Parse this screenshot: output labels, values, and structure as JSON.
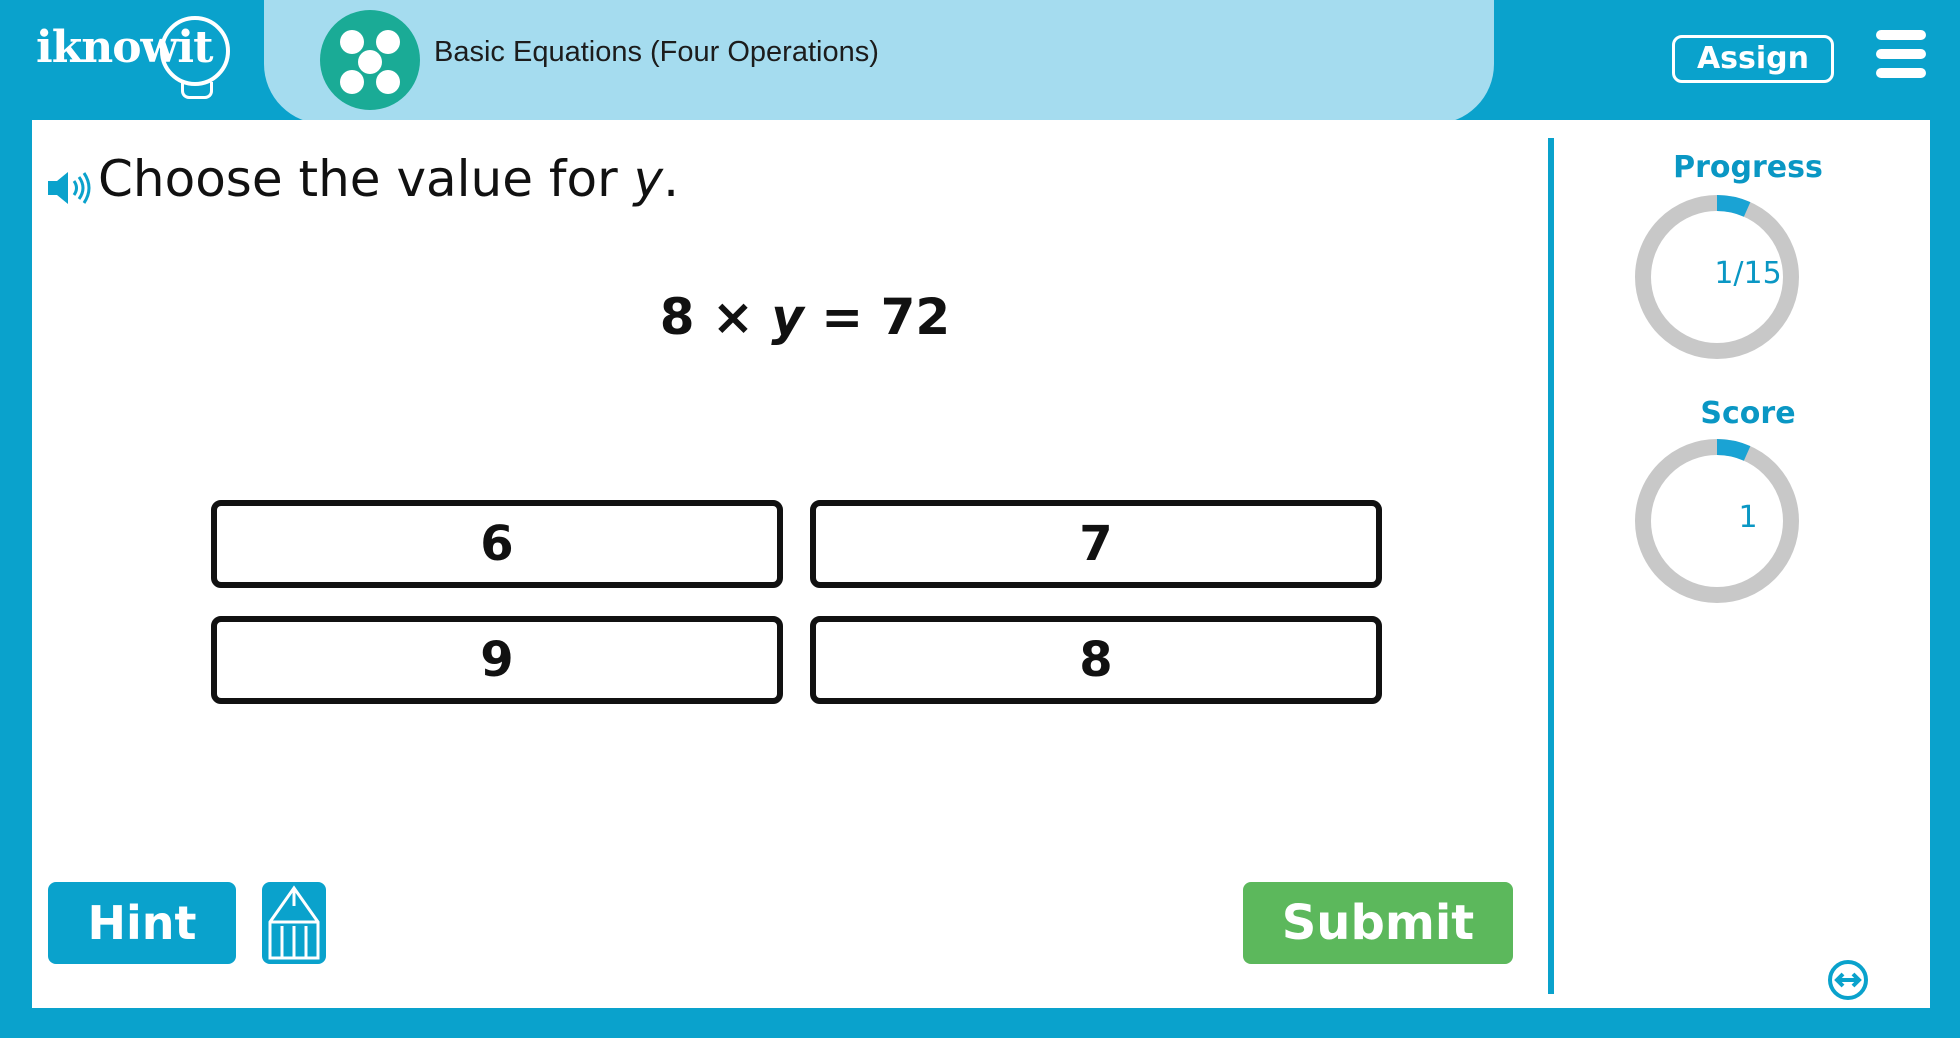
{
  "header": {
    "logo_text": "iknowit",
    "lesson_title": "Basic Equations (Four Operations)",
    "assign_label": "Assign",
    "icons": {
      "lesson": "dots-icon",
      "menu": "hamburger-menu-icon"
    }
  },
  "question": {
    "prompt_text": "Choose the value for ",
    "prompt_var": "y",
    "prompt_end": ".",
    "equation_left": "8 × ",
    "equation_var": "y",
    "equation_right": " = 72",
    "speaker_icon": "speaker-icon"
  },
  "answers": [
    "6",
    "7",
    "9",
    "8"
  ],
  "footer": {
    "hint_label": "Hint",
    "submit_label": "Submit",
    "pencil_icon": "pencil-icon"
  },
  "sidebar": {
    "progress_label": "Progress",
    "progress_text": "1/15",
    "progress_fraction": 0.0667,
    "score_label": "Score",
    "score_text": "1",
    "score_fraction": 0.0667,
    "expand_icon": "expand-arrows-icon"
  },
  "colors": {
    "brand_blue": "#0aa2cc",
    "title_pill": "#a5dcef",
    "lesson_icon": "#1aab96",
    "submit_green": "#5cb85c",
    "ring_track": "#c8c8c8"
  }
}
